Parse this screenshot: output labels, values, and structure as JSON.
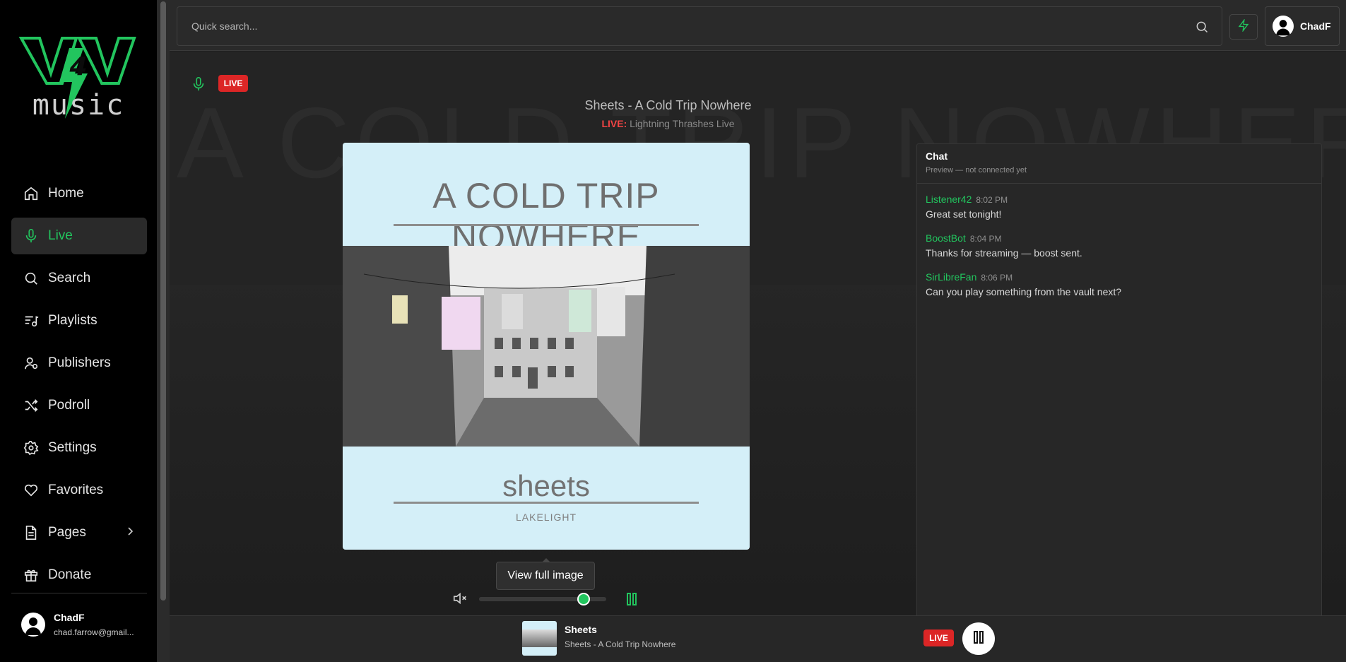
{
  "brand": {
    "line1": "V4V",
    "line2": "music",
    "accent": "#22c55e"
  },
  "sidebar": {
    "items": [
      {
        "label": "Home",
        "icon": "home-icon"
      },
      {
        "label": "Live",
        "icon": "mic-icon",
        "active": true
      },
      {
        "label": "Search",
        "icon": "search-icon"
      },
      {
        "label": "Playlists",
        "icon": "playlist-icon"
      },
      {
        "label": "Publishers",
        "icon": "publishers-icon"
      },
      {
        "label": "Podroll",
        "icon": "shuffle-icon"
      },
      {
        "label": "Settings",
        "icon": "gear-icon"
      },
      {
        "label": "Favorites",
        "icon": "heart-icon"
      },
      {
        "label": "Pages",
        "icon": "document-icon",
        "has_submenu": true
      },
      {
        "label": "Donate",
        "icon": "gift-icon"
      }
    ],
    "user": {
      "name": "ChadF",
      "email": "chad.farrow@gmail..."
    }
  },
  "header": {
    "search_placeholder": "Quick search...",
    "user_name": "ChadF"
  },
  "now_live": {
    "badge": "LIVE",
    "title": "Sheets - A Cold Trip Nowhere",
    "live_label": "LIVE:",
    "show": "Lightning Thrashes Live",
    "background_text": "A COLD TRIP NOWHERE"
  },
  "album_art": {
    "title": "A COLD TRIP NOWHERE",
    "album": "sheets",
    "artist": "LAKELIGHT",
    "tooltip": "View full image"
  },
  "player": {
    "volume": 0.82,
    "muted": true
  },
  "chat": {
    "title": "Chat",
    "status": "Preview — not connected yet",
    "messages": [
      {
        "user": "Listener42",
        "time": "8:02 PM",
        "text": "Great set tonight!"
      },
      {
        "user": "BoostBot",
        "time": "8:04 PM",
        "text": "Thanks for streaming — boost sent."
      },
      {
        "user": "SirLibreFan",
        "time": "8:06 PM",
        "text": "Can you play something from the vault next?"
      }
    ]
  },
  "bottom_bar": {
    "title": "Sheets",
    "subtitle": "Sheets - A Cold Trip Nowhere",
    "badge": "LIVE"
  }
}
